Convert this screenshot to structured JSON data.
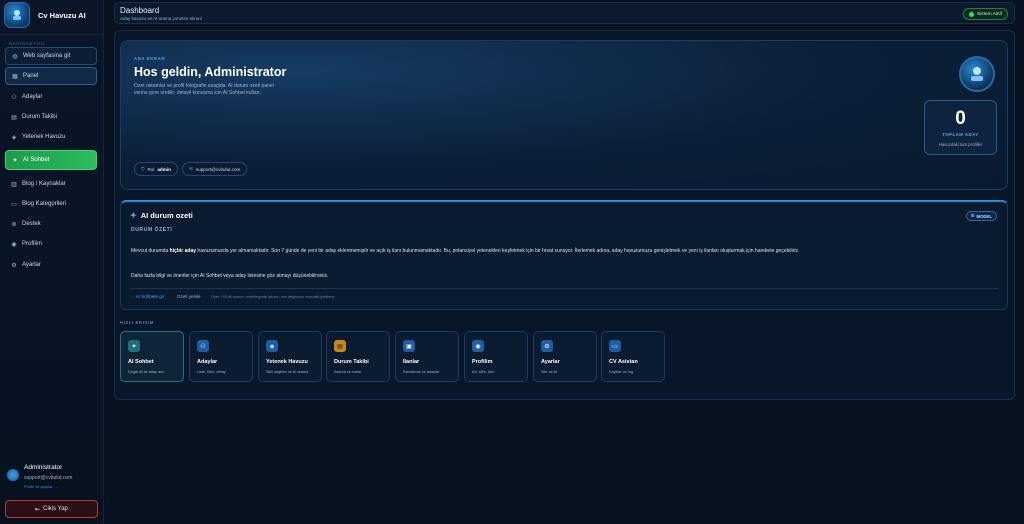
{
  "app": {
    "title": "Cv Havuzu AI"
  },
  "sidebar": {
    "heading": "NAVIGASYON",
    "items": [
      {
        "label": "Web sayfasina git",
        "icon": "globe-icon"
      },
      {
        "label": "Panel",
        "icon": "dashboard-icon"
      },
      {
        "label": "Adaylar",
        "icon": "users-icon"
      },
      {
        "label": "Durum Takibi",
        "icon": "clipboard-icon"
      },
      {
        "label": "Yetenek Havuzu",
        "icon": "tag-icon"
      },
      {
        "label": "AI Sohbet",
        "icon": "sparkles-icon"
      },
      {
        "label": "Blog / Kaynaklar",
        "icon": "book-icon"
      },
      {
        "label": "Blog Kategorileri",
        "icon": "folder-icon"
      },
      {
        "label": "Destek",
        "icon": "lifebuoy-icon"
      },
      {
        "label": "Profilim",
        "icon": "user-circle-icon"
      },
      {
        "label": "Ayarlar",
        "icon": "gear-icon"
      }
    ],
    "user": {
      "name": "Administrator",
      "email": "support@cvbulut.com",
      "link": "Profili ve ayarlar →"
    },
    "logout_label": "Cikis Yap"
  },
  "topbar": {
    "title": "Dashboard",
    "subtitle": "Aday havuzu ve AI arama yonetim ekrani",
    "status": "Sistem Aktif"
  },
  "hero": {
    "eyebrow": "ANA EKRAN",
    "title": "Hos geldin, Administrator",
    "description": "Ozet rakamlar ve profil fotografin asagida. AI durum ozeti panel verine gore uretilir; detayli konusma icin AI Sohbet kullan.",
    "chip_role_label": "Rol",
    "chip_role_value": "admin",
    "chip_email": "support@cvbulut.com",
    "count_value": "0",
    "count_label": "TOPLAM ADAY",
    "count_sub": "Havuzdaki tum profiller"
  },
  "ai_summary": {
    "title": "AI durum ozeti",
    "model_label": "MODEL",
    "subheading": "DURUM ÖZETİ",
    "text_before": "Mevcut durumda ",
    "text_bold": "hiçbir aday",
    "text_after": " havuzumuzda yer almamaktadır. Son 7 günde de yeni bir aday eklenmemiştir ve açık iş ilanı bulunmamaktadır. Bu, potansiyel yetenekleri keşfetmek için bir fırsat sunuyor. İlerlemek adına, aday havuzumuzu genişletmek ve yeni iş ilanları oluşturmak için harekete geçebiliriz.",
    "text2": "Daha fazla bilgi ve öneriler için AI Sohbet veya aday listesine göz atmayı düşünebilirsiniz.",
    "link_chat": "AI Sohbete git",
    "link_refresh": "Ozeti yenile",
    "note": "Ozet ~15 dk oturum onbelleginde tutulur; veri degisince otomatik yenilenir."
  },
  "quick_access": {
    "heading": "HIZLI ERISIM",
    "cards": [
      {
        "title": "AI Sohbet",
        "sub": "Dogal dil ile aday ara",
        "icon": "sparkles-icon"
      },
      {
        "title": "Adaylar",
        "sub": "Liste, filtre, detay",
        "icon": "users-icon"
      },
      {
        "title": "Yetenek Havuzu",
        "sub": "Skill dagilimi ve AI arama",
        "icon": "tag-icon"
      },
      {
        "title": "Durum Takibi",
        "sub": "Asama ve notlar",
        "icon": "clipboard-icon"
      },
      {
        "title": "Ilanlar",
        "sub": "Eslestirme ve adaylar",
        "icon": "briefcase-icon"
      },
      {
        "title": "Profilim",
        "sub": "Ad, sifre, foto",
        "icon": "user-circle-icon"
      },
      {
        "title": "Ayarlar",
        "sub": "Site ve AI",
        "icon": "gear-icon"
      },
      {
        "title": "CV Asistan",
        "sub": "Kayitlar ve log",
        "icon": "chat-icon"
      }
    ]
  },
  "colors": {
    "background": "#07111f",
    "accent_blue": "#2e8ad8",
    "active_green": "#2bbd5e",
    "status_green": "#2fe07a",
    "logout_red": "#b03a3a"
  }
}
